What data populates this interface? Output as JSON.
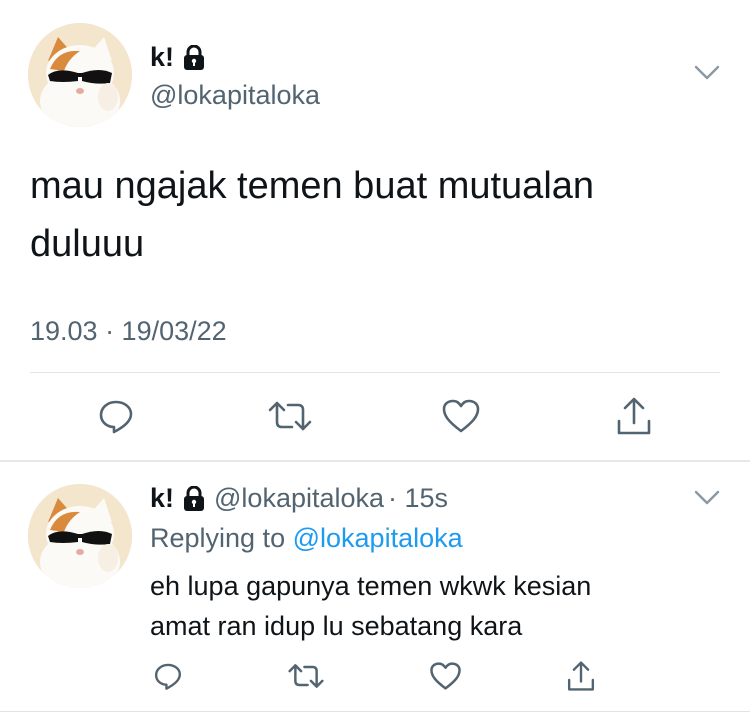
{
  "main_tweet": {
    "display_name": "k!",
    "handle": "@lokapitaloka",
    "text_line1": "mau ngajak temen buat mutualan",
    "text_line2": "duluuu",
    "timestamp": "19.03 · 19/03/22"
  },
  "reply_tweet": {
    "display_name": "k!",
    "handle": "@lokapitaloka",
    "separator_time": "· 15s",
    "replying_prefix": "Replying to",
    "replying_handle": "@lokapitaloka",
    "text_line1": "eh lupa gapunya temen wkwk kesian",
    "text_line2": "amat ran idup lu sebatang kara"
  },
  "icons": {
    "lock": "lock-icon",
    "chevron": "chevron-down-icon",
    "reply": "reply-icon",
    "retweet": "retweet-icon",
    "like": "heart-icon",
    "share": "share-icon"
  },
  "colors": {
    "text": "#0f1419",
    "secondary": "#536471",
    "link": "#1d9bf0",
    "divider": "#e1e4e7"
  }
}
